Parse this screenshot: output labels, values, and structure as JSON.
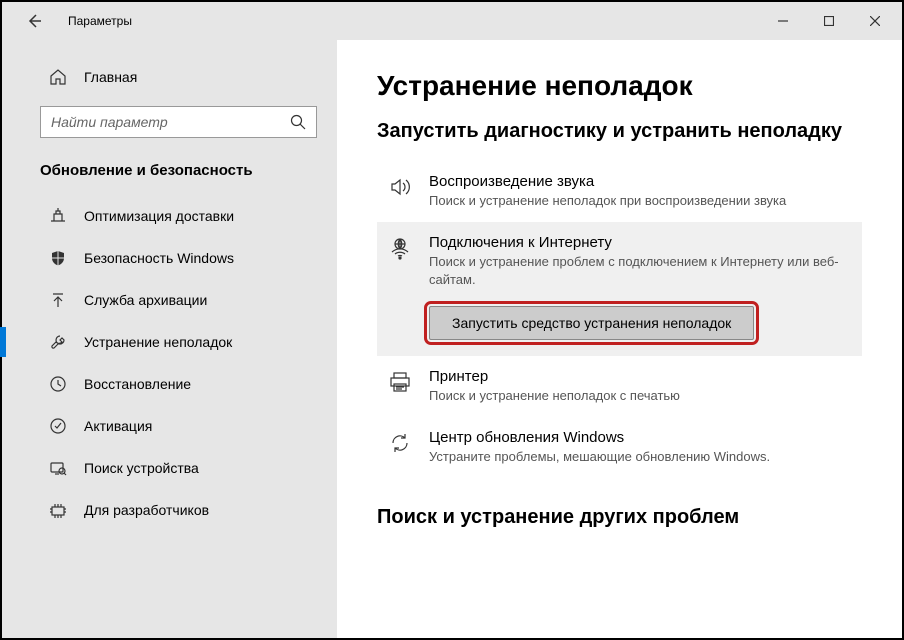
{
  "window": {
    "title": "Параметры"
  },
  "sidebar": {
    "home_label": "Главная",
    "search_placeholder": "Найти параметр",
    "section_header": "Обновление и безопасность",
    "items": [
      {
        "label": "Оптимизация доставки",
        "icon": "delivery"
      },
      {
        "label": "Безопасность Windows",
        "icon": "shield"
      },
      {
        "label": "Служба архивации",
        "icon": "backup"
      },
      {
        "label": "Устранение неполадок",
        "icon": "troubleshoot",
        "active": true
      },
      {
        "label": "Восстановление",
        "icon": "recovery"
      },
      {
        "label": "Активация",
        "icon": "activation"
      },
      {
        "label": "Поиск устройства",
        "icon": "find-device"
      },
      {
        "label": "Для разработчиков",
        "icon": "developer"
      }
    ]
  },
  "main": {
    "title": "Устранение неполадок",
    "subtitle": "Запустить диагностику и устранить неполадку",
    "items": [
      {
        "title": "Воспроизведение звука",
        "desc": "Поиск и устранение неполадок при воспроизведении звука"
      },
      {
        "title": "Подключения к Интернету",
        "desc": "Поиск и устранение проблем с подключением к Интернету или веб-сайтам.",
        "selected": true,
        "button": "Запустить средство устранения неполадок"
      },
      {
        "title": "Принтер",
        "desc": "Поиск и устранение неполадок с печатью"
      },
      {
        "title": "Центр обновления Windows",
        "desc": "Устраните проблемы, мешающие обновлению Windows."
      }
    ],
    "section2": "Поиск и устранение других проблем"
  }
}
